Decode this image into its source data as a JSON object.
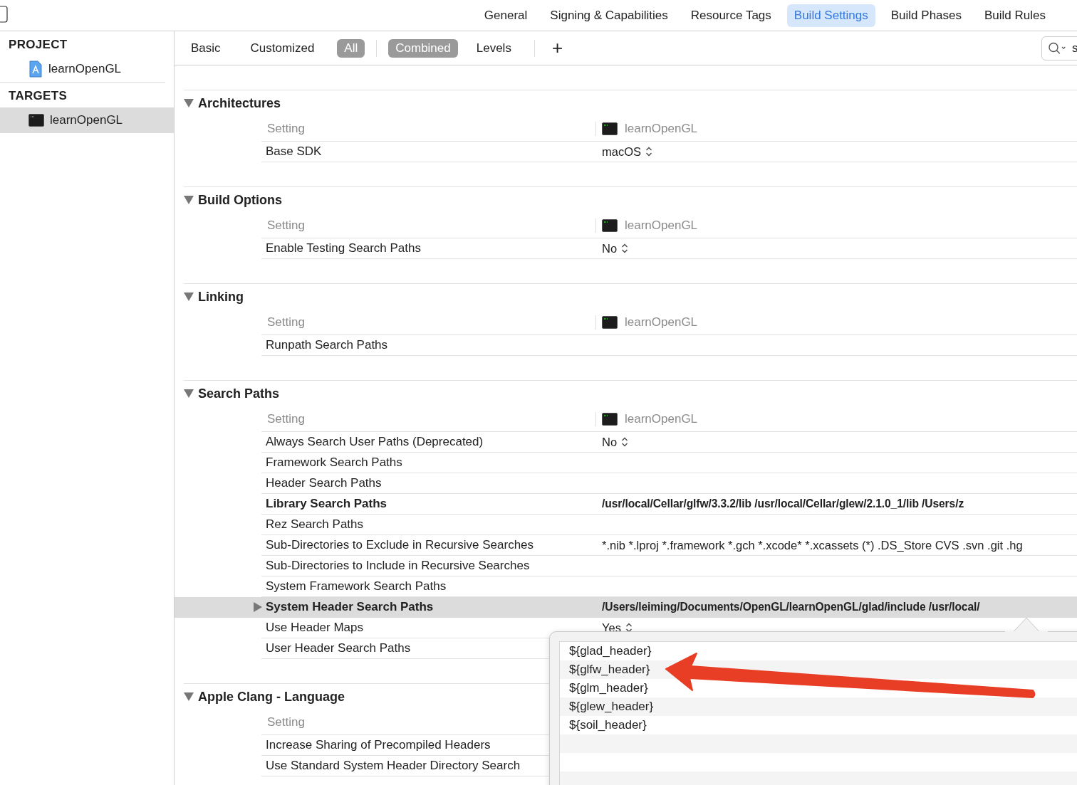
{
  "tabs": [
    {
      "label": "General",
      "selected": false
    },
    {
      "label": "Signing & Capabilities",
      "selected": false
    },
    {
      "label": "Resource Tags",
      "selected": false
    },
    {
      "label": "Build Settings",
      "selected": true
    },
    {
      "label": "Build Phases",
      "selected": false
    },
    {
      "label": "Build Rules",
      "selected": false
    }
  ],
  "sidebar": {
    "groups": [
      {
        "title": "PROJECT",
        "items": [
          {
            "label": "learnOpenGL",
            "kind": "project",
            "selected": false
          }
        ]
      },
      {
        "title": "TARGETS",
        "items": [
          {
            "label": "learnOpenGL",
            "kind": "target",
            "selected": true
          }
        ]
      }
    ]
  },
  "filters": [
    {
      "label": "Basic",
      "selected": false
    },
    {
      "label": "Customized",
      "selected": false
    },
    {
      "label": "All",
      "selected": true
    }
  ],
  "views": [
    {
      "label": "Combined",
      "selected": true
    },
    {
      "label": "Levels",
      "selected": false
    }
  ],
  "add_button": "+",
  "search": {
    "value": "s"
  },
  "sections": [
    {
      "title": "Architectures",
      "expanded": true,
      "header": {
        "setting": "Setting",
        "target": "learnOpenGL"
      },
      "rows": [
        {
          "label": "Base SDK",
          "value": "macOS",
          "kind": "popup",
          "bold": false,
          "selected": false
        }
      ]
    },
    {
      "title": "Build Options",
      "expanded": true,
      "header": {
        "setting": "Setting",
        "target": "learnOpenGL"
      },
      "rows": [
        {
          "label": "Enable Testing Search Paths",
          "value": "No",
          "kind": "popup",
          "bold": false,
          "selected": false
        }
      ]
    },
    {
      "title": "Linking",
      "expanded": true,
      "header": {
        "setting": "Setting",
        "target": "learnOpenGL"
      },
      "rows": [
        {
          "label": "Runpath Search Paths",
          "kind": "text",
          "bold": false,
          "selected": false
        }
      ]
    },
    {
      "title": "Search Paths",
      "expanded": true,
      "header": {
        "setting": "Setting",
        "target": "learnOpenGL"
      },
      "rows": [
        {
          "label": "Always Search User Paths (Deprecated)",
          "value": "No",
          "kind": "popup",
          "bold": false,
          "selected": false
        },
        {
          "label": "Framework Search Paths",
          "kind": "text",
          "bold": false,
          "selected": false
        },
        {
          "label": "Header Search Paths",
          "kind": "text",
          "bold": false,
          "selected": false
        },
        {
          "label": "Library Search Paths",
          "value": "/usr/local/Cellar/glfw/3.3.2/lib /usr/local/Cellar/glew/2.1.0_1/lib /Users/z",
          "kind": "text",
          "bold": true,
          "selected": false
        },
        {
          "label": "Rez Search Paths",
          "kind": "text",
          "bold": false,
          "selected": false
        },
        {
          "label": "Sub-Directories to Exclude in Recursive Searches",
          "value": "*.nib *.lproj *.framework *.gch *.xcode* *.xcassets (*) .DS_Store CVS .svn .git .hg",
          "kind": "text",
          "bold": false,
          "selected": false
        },
        {
          "label": "Sub-Directories to Include in Recursive Searches",
          "kind": "text",
          "bold": false,
          "selected": false
        },
        {
          "label": "System Framework Search Paths",
          "kind": "text",
          "bold": false,
          "selected": false
        },
        {
          "label": "System Header Search Paths",
          "value": "/Users/leiming/Documents/OpenGL/learnOpenGL/glad/include /usr/local/",
          "kind": "text",
          "bold": true,
          "selected": true,
          "expanded": false
        },
        {
          "label": "Use Header Maps",
          "value": "Yes",
          "kind": "popup",
          "bold": false,
          "selected": false
        },
        {
          "label": "User Header Search Paths",
          "kind": "text",
          "bold": false,
          "selected": false
        }
      ]
    },
    {
      "title": "Apple Clang - Language",
      "expanded": true,
      "header": {
        "setting": "Setting"
      },
      "rows": [
        {
          "label": "Increase Sharing of Precompiled Headers",
          "kind": "text",
          "bold": false,
          "selected": false
        },
        {
          "label": "Use Standard System Header Directory Search",
          "kind": "text",
          "bold": false,
          "selected": false
        }
      ]
    }
  ],
  "popover": {
    "items": [
      "${glad_header}",
      "${glfw_header}",
      "${glm_header}",
      "${glew_header}",
      "${soil_header}"
    ]
  }
}
